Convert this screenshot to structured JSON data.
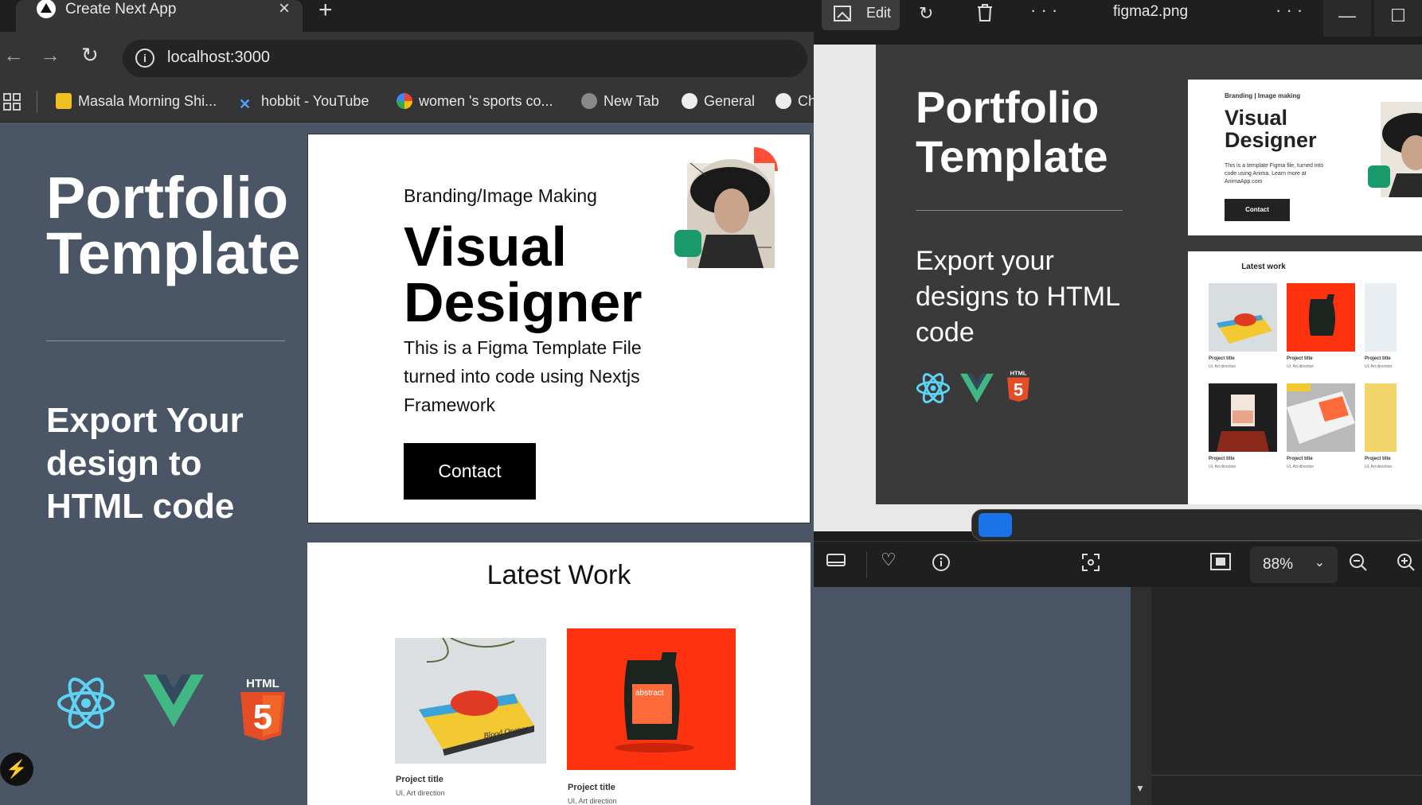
{
  "browser": {
    "tab_title": "Create Next App",
    "tab_close": "×",
    "new_tab": "+",
    "url": "localhost:3000",
    "bookmarks": [
      "Masala Morning Shi...",
      "hobbit - YouTube",
      "women 's sports co...",
      "New Tab",
      "General",
      "Ch"
    ]
  },
  "page": {
    "hero_title_line1": "Portfolio",
    "hero_title_line2": "Template",
    "hero_sub": "Export Your design to HTML code",
    "card": {
      "kicker": "Branding/Image Making",
      "head_line1": "Visual",
      "head_line2": "Designer",
      "body": "This is a Figma Template File turned into code using Nextjs Framework",
      "button": "Contact"
    },
    "latest_work": {
      "title": "Latest Work",
      "projects": [
        {
          "title": "Project title",
          "sub": "UI, Art direction",
          "label": "Blood Orange"
        },
        {
          "title": "Project title",
          "sub": "UI, Art direction",
          "label": "abstract"
        }
      ]
    },
    "html_badge": "HTML",
    "html_five": "5"
  },
  "viewer": {
    "edit_label": "Edit",
    "file_name": "figma2.png",
    "more": "· · ·",
    "zoom": "88%",
    "art": {
      "title_line1": "Portfolio",
      "title_line2": "Template",
      "sub": "Export your designs to HTML code",
      "mini_kicker": "Branding | Image making",
      "mini_head_line1": "Visual",
      "mini_head_line2": "Designer",
      "mini_body": "This is a template Figma file, turned into code using Anima. Learn more at AnimaApp.com",
      "mini_button": "Contact",
      "latest_work": "Latest work",
      "proj_title": "Project title",
      "proj_sub": "UI, Art direction"
    }
  },
  "colors": {
    "page_bg": "#4a5566",
    "react": "#5ed3f3",
    "vue": "#41b883",
    "html5": "#e44d26",
    "accent_red": "#ff3b1f",
    "accent_green": "#1a9a6c"
  }
}
